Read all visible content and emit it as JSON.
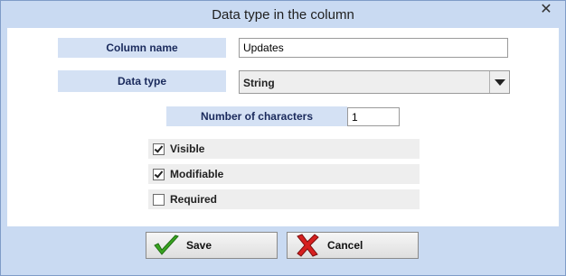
{
  "window": {
    "title": "Data type in the column",
    "close_symbol": "✕"
  },
  "form": {
    "column_name_label": "Column name",
    "column_name_value": "Updates",
    "data_type_label": "Data type",
    "data_type_value": "String",
    "num_chars_label": "Number of characters",
    "num_chars_value": "1"
  },
  "options": [
    {
      "label": "Visible",
      "checked": true
    },
    {
      "label": "Modifiable",
      "checked": true
    },
    {
      "label": "Required",
      "checked": false
    }
  ],
  "buttons": {
    "save_label": "Save",
    "save_icon": "checkmark-icon",
    "cancel_label": "Cancel",
    "cancel_icon": "x-icon"
  },
  "colors": {
    "frame": "#c9daf2",
    "label_bg": "#d4e1f4",
    "label_text": "#1a2a5c",
    "save_check": "#3aa521",
    "cancel_x": "#d62020"
  }
}
